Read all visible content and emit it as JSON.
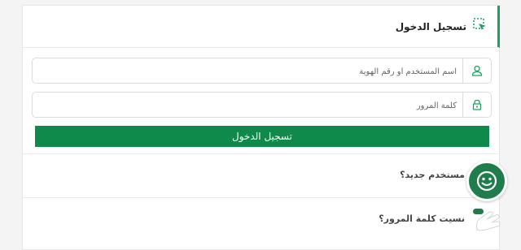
{
  "header": {
    "title": "تسجيل الدخول",
    "icon": "pointer-select-icon"
  },
  "form": {
    "username": {
      "placeholder": "اسم المستخدم أو رقم الهوية",
      "value": "",
      "icon": "user-icon"
    },
    "password": {
      "placeholder": "كلمة المرور",
      "value": "",
      "icon": "lock-icon"
    },
    "submit_label": "تسجيل الدخول"
  },
  "links": {
    "new_user": "مستخدم جديد؟",
    "forgot_password": "نسيت كلمة المرور؟"
  },
  "colors": {
    "accent": "#0f8a4a",
    "edge": "#1aa260",
    "chat": "#1e7d4a"
  }
}
